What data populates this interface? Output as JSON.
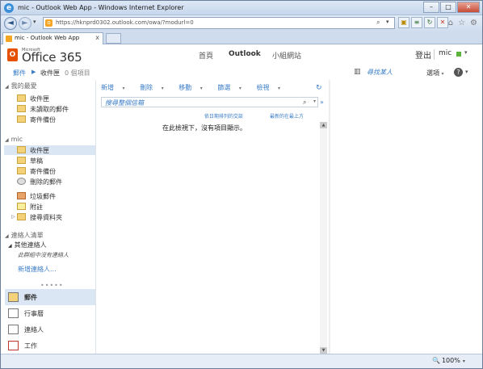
{
  "window": {
    "title": "mic - Outlook Web App - Windows Internet Explorer"
  },
  "window_buttons": {
    "minimize": "–",
    "maximize": "□",
    "close": "✕"
  },
  "browser": {
    "url": "https://hknprd0302.outlook.com/owa/?modurl=0",
    "tab_title": "mic - Outlook Web App",
    "tab_close": "x",
    "back_glyph": "◄",
    "forward_glyph": "►",
    "search_glyph": "⌕",
    "dropdown_glyph": "▾"
  },
  "app": {
    "logo_small": "Microsoft",
    "logo_text": "Office 365",
    "nav": [
      "首頁",
      "Outlook",
      "小組網站"
    ],
    "sign_out": "登出",
    "user": "mic",
    "user_dropdown": "▾"
  },
  "breadcrumb": {
    "root": "郵件",
    "arrow": "▶",
    "current": "收件匣",
    "count": "0 個項目",
    "find_someone": "尋找某人",
    "options": "選項",
    "options_dropdown": "▾",
    "help": "?",
    "help_dropdown": "▾"
  },
  "sidebar": {
    "favorites_header": "我的最愛",
    "favorites": [
      "收件匣",
      "未讀取的郵件",
      "寄件備份"
    ],
    "mailbox_header": "mic",
    "folders": [
      "收件匣",
      "草稿",
      "寄件備份",
      "刪除的郵件",
      "垃圾郵件",
      "附註",
      "搜尋資料夾"
    ],
    "contacts_header": "連絡人清單",
    "contacts_group": "其他連絡人",
    "contacts_empty": "此群組中沒有連絡人",
    "add_contact": "新增連絡人...",
    "dots": "•••••"
  },
  "bottom_nav": [
    "郵件",
    "行事曆",
    "連絡人",
    "工作"
  ],
  "toolbar": {
    "items": [
      "新增",
      "刪除",
      "移動",
      "篩選",
      "檢視"
    ],
    "dropdown_glyph": "▾",
    "refresh_glyph": "↻"
  },
  "search": {
    "placeholder": "搜尋整個信箱",
    "magnifier": "⌕",
    "dropdown": "▾",
    "expand": "»"
  },
  "list": {
    "arrange_by": "依日期排列的交談",
    "sort_order": "最新的在最上方",
    "empty_message": "在此檢視下，沒有項目顯示。",
    "scroll_up": "▲",
    "scroll_down": "▼"
  },
  "status": {
    "zoom": "100%",
    "zoom_icon": "🔍",
    "zoom_dropdown": "▾"
  },
  "colors": {
    "accent": "#3a7cc7",
    "logo": "#e65100",
    "presence": "#5bb43a",
    "selected": "#dbe6f4"
  }
}
